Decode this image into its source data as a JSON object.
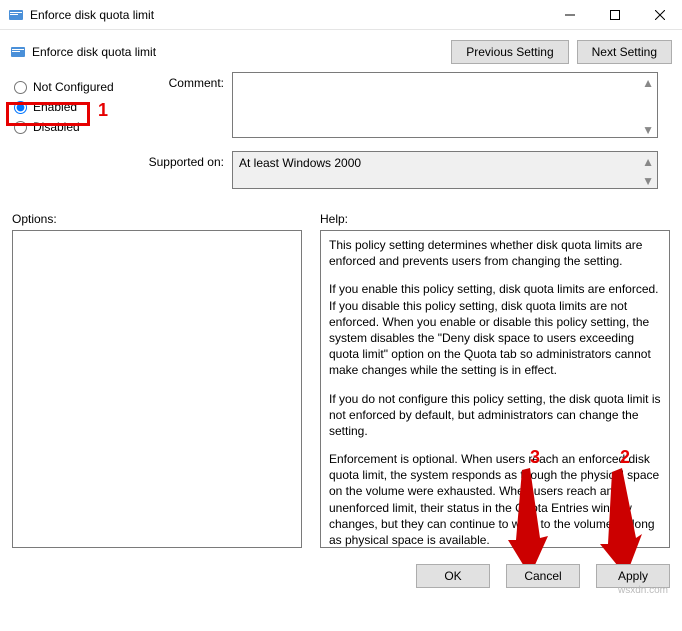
{
  "window": {
    "title": "Enforce disk quota limit",
    "subtitle": "Enforce disk quota limit"
  },
  "nav": {
    "previous": "Previous Setting",
    "next": "Next Setting"
  },
  "radios": {
    "not_configured": "Not Configured",
    "enabled": "Enabled",
    "disabled": "Disabled",
    "selected": "enabled"
  },
  "labels": {
    "comment": "Comment:",
    "supported": "Supported on:",
    "options": "Options:",
    "help": "Help:"
  },
  "fields": {
    "comment_value": "",
    "supported_value": "At least Windows 2000"
  },
  "help": {
    "p1": "This policy setting determines whether disk quota limits are enforced and prevents users from changing the setting.",
    "p2": "If you enable this policy setting, disk quota limits are enforced. If you disable this policy setting, disk quota limits are not enforced. When you enable or disable this policy setting, the system disables the \"Deny disk space to users exceeding quota limit\" option on the Quota tab so administrators cannot make changes while the setting is in effect.",
    "p3": "If you do not configure this policy setting, the disk quota limit is not enforced by default, but administrators can change the setting.",
    "p4": "Enforcement is optional. When users reach an enforced disk quota limit, the system responds as though the physical space on the volume were exhausted. When users reach an unenforced limit, their status in the Quota Entries window changes, but they can continue to write to the volume as long as physical space is available."
  },
  "footer": {
    "ok": "OK",
    "cancel": "Cancel",
    "apply": "Apply"
  },
  "annotations": {
    "n1": "1",
    "n2": "2",
    "n3": "3"
  },
  "watermark": "wsxdn.com"
}
